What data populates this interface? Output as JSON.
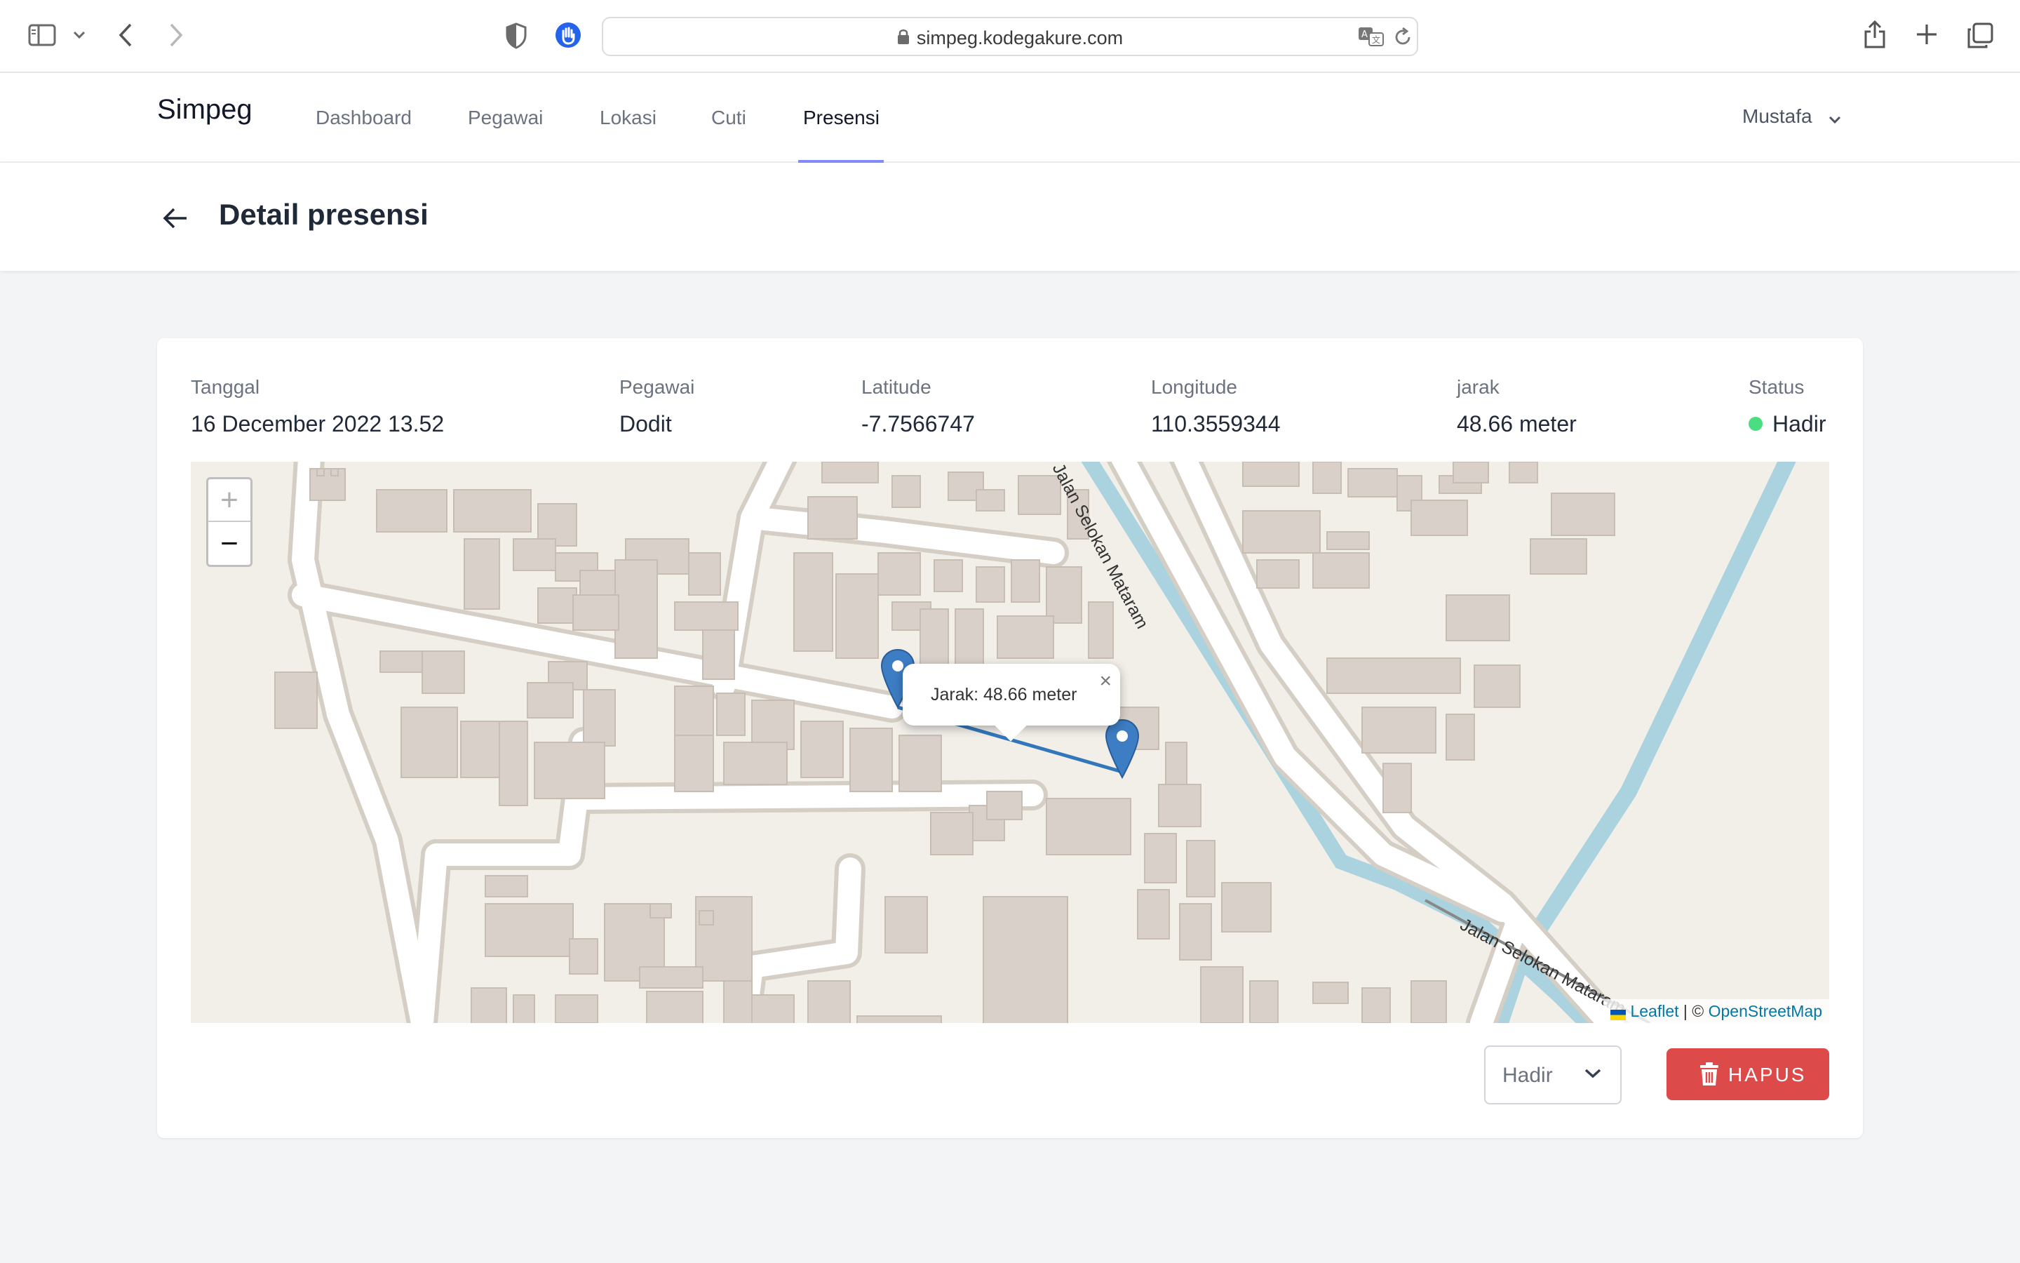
{
  "browser": {
    "url": "simpeg.kodegakure.com",
    "icons": [
      "sidebar-icon",
      "chevron-down-icon",
      "back-icon",
      "forward-icon",
      "shield-icon",
      "privacy-hand-icon",
      "lock-icon",
      "translate-icon",
      "reload-icon",
      "share-icon",
      "new-tab-icon",
      "tabs-icon"
    ]
  },
  "nav": {
    "brand": "Simpeg",
    "items": [
      {
        "label": "Dashboard"
      },
      {
        "label": "Pegawai"
      },
      {
        "label": "Lokasi"
      },
      {
        "label": "Cuti"
      },
      {
        "label": "Presensi",
        "active": true
      }
    ],
    "user": "Mustafa"
  },
  "page": {
    "title": "Detail presensi"
  },
  "detail": {
    "tanggal": {
      "label": "Tanggal",
      "value": "16 December 2022 13.52"
    },
    "pegawai": {
      "label": "Pegawai",
      "value": "Dodit"
    },
    "latitude": {
      "label": "Latitude",
      "value": "-7.7566747"
    },
    "longitude": {
      "label": "Longitude",
      "value": "110.3559344"
    },
    "jarak": {
      "label": "jarak",
      "value": "48.66 meter"
    },
    "status": {
      "label": "Status",
      "value": "Hadir",
      "color": "#4ade80"
    }
  },
  "map": {
    "zoom_in": "+",
    "zoom_out": "−",
    "popup_text": "Jarak: 48.66 meter",
    "popup_close": "×",
    "street_1": "Jalan Selokan Mataram",
    "street_2": "Jalan Selokan Mataram",
    "attribution": {
      "leaflet": "Leaflet",
      "separator": " | © ",
      "osm": "OpenStreetMap"
    },
    "colors": {
      "water": "#aad3df",
      "building": "#d9d0c9",
      "land": "#f2efe9",
      "marker": "#3d7dc4",
      "line": "#3377bb"
    }
  },
  "actions": {
    "status_select": "Hadir",
    "delete_label": "HAPUS",
    "delete_color": "#dc4a4a"
  }
}
